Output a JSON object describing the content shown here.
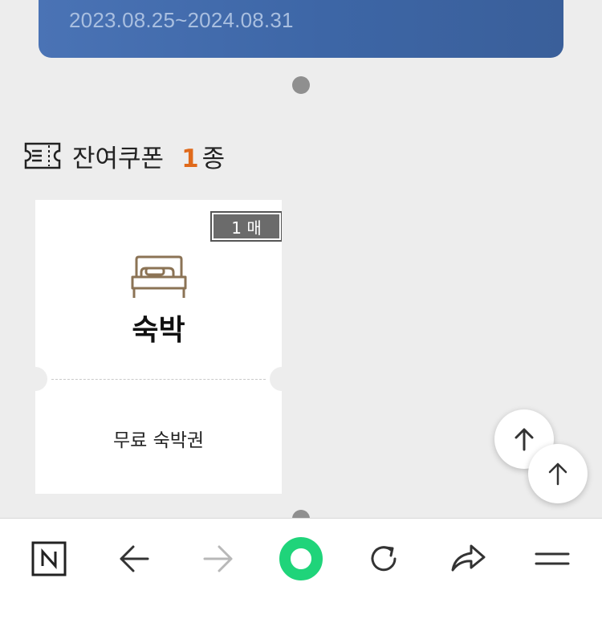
{
  "banner": {
    "date_range": "2023.08.25~2024.08.31"
  },
  "section": {
    "title": "잔여쿠폰",
    "count": "1",
    "unit": "종",
    "icon": "ticket-icon"
  },
  "coupon": {
    "badge": "1 매",
    "title": "숙박",
    "description": "무료 숙박권",
    "icon": "bed-icon",
    "icon_color": "#8b7355"
  },
  "fabs": [
    {
      "icon": "arrow-up-icon"
    },
    {
      "icon": "arrow-up-icon"
    }
  ],
  "bottom_nav": [
    {
      "name": "naver-home",
      "icon": "naver-n-icon"
    },
    {
      "name": "back",
      "icon": "arrow-left-icon"
    },
    {
      "name": "forward",
      "icon": "arrow-right-icon",
      "disabled": true
    },
    {
      "name": "green-dot",
      "icon": "green-ring-icon",
      "color": "#1fd47a"
    },
    {
      "name": "refresh",
      "icon": "refresh-icon"
    },
    {
      "name": "share",
      "icon": "share-icon"
    },
    {
      "name": "menu",
      "icon": "menu-icon"
    }
  ]
}
